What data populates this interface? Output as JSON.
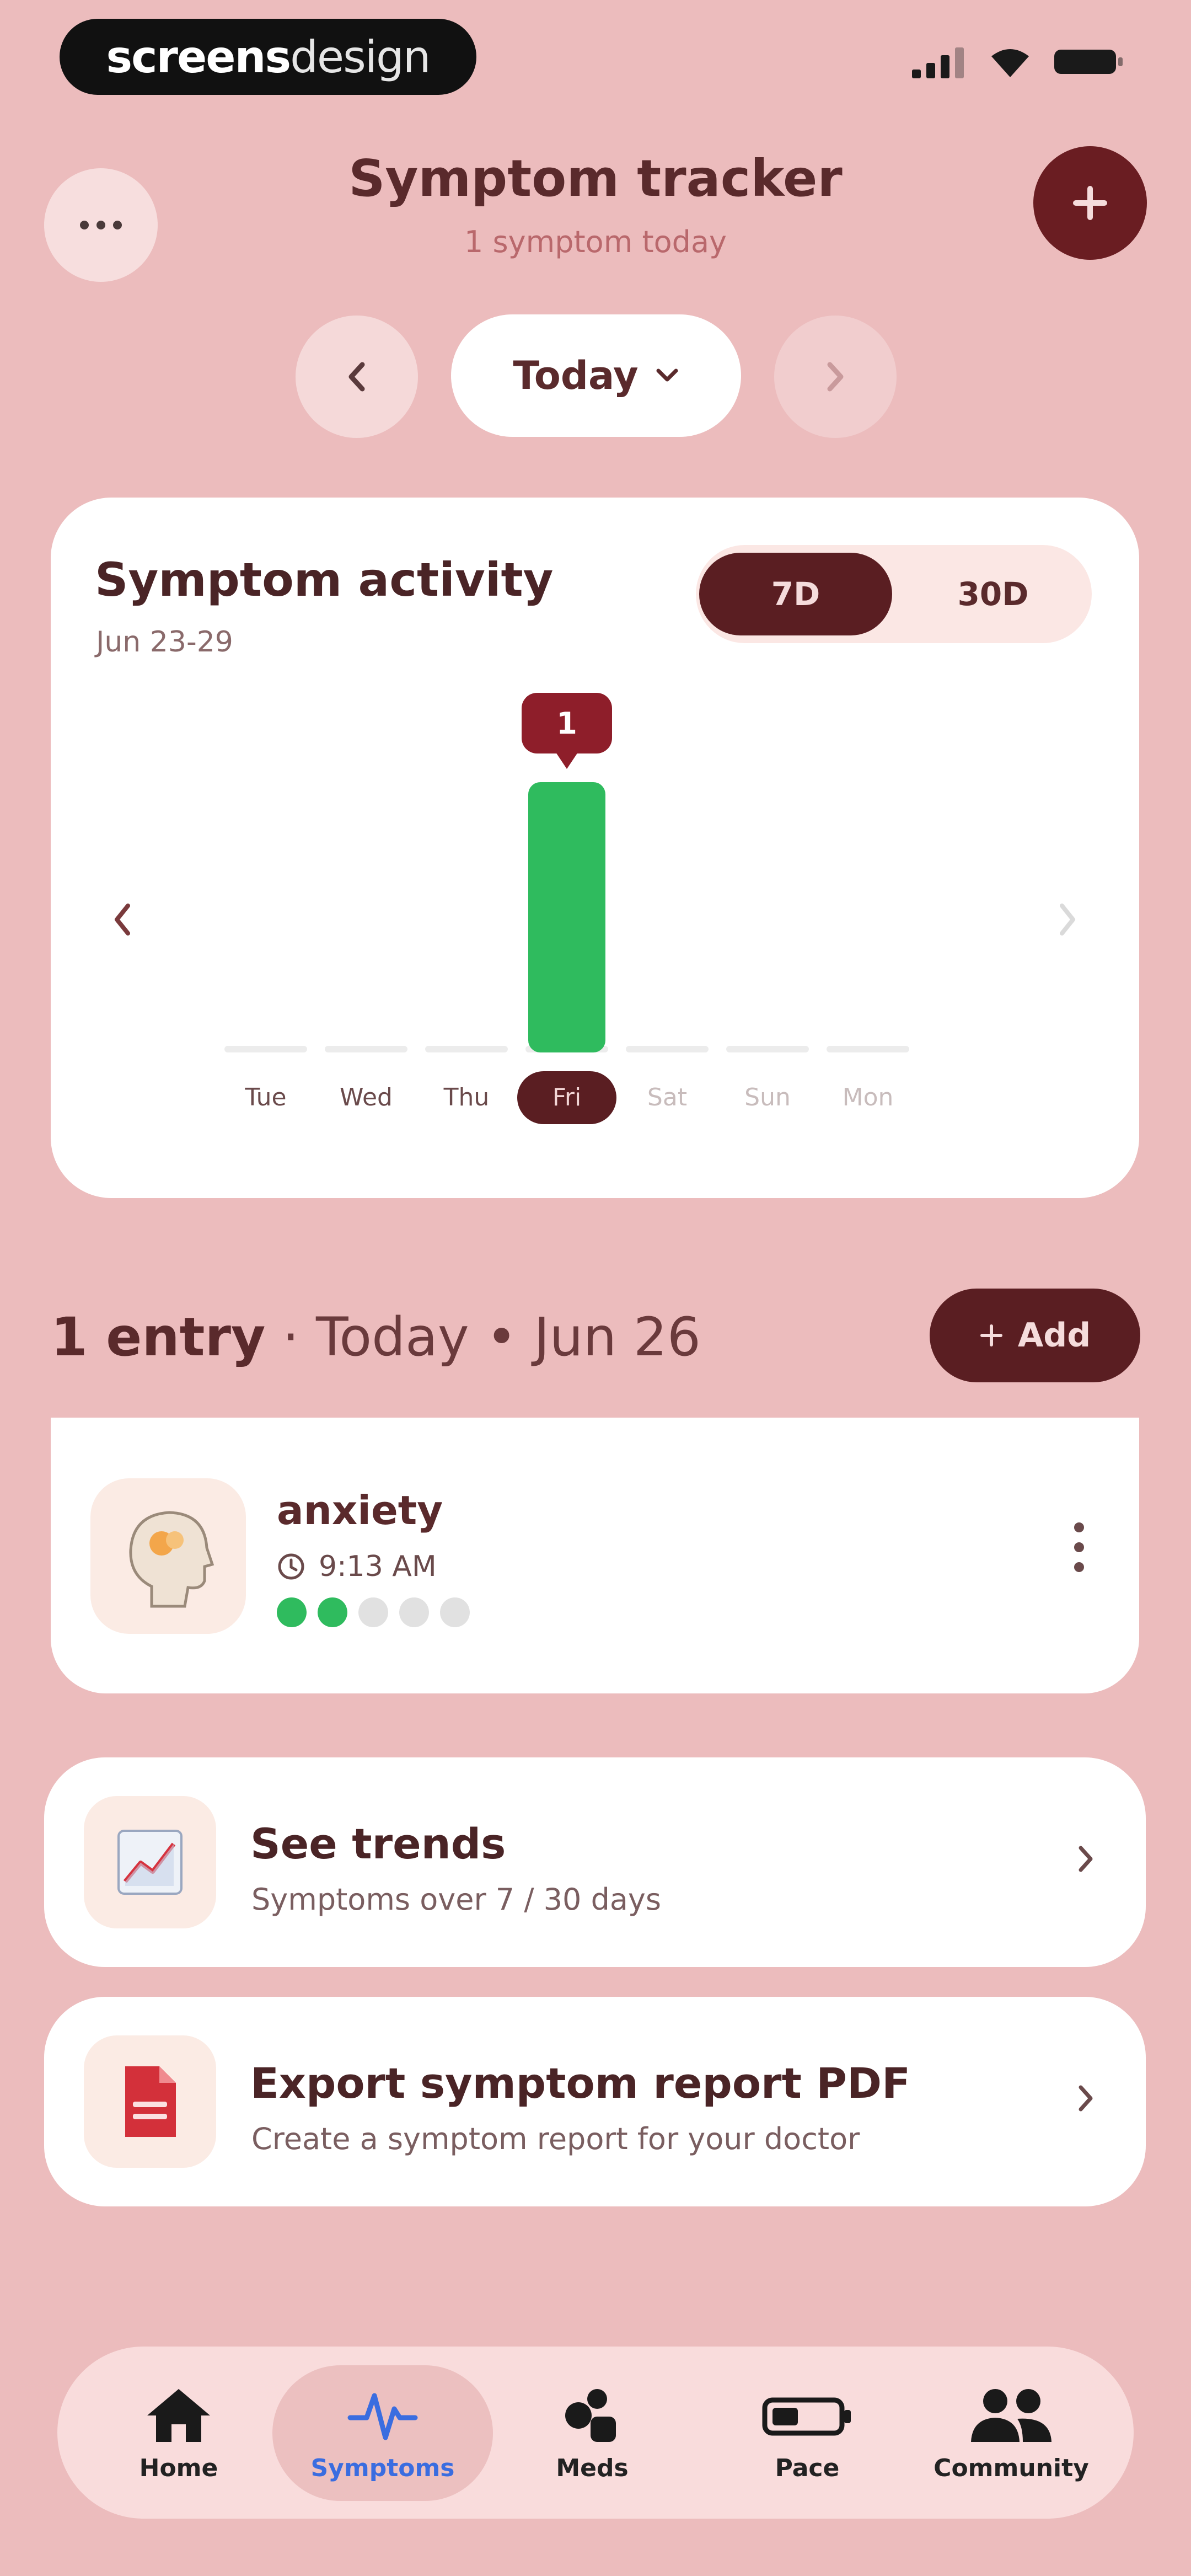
{
  "status_bar": {
    "brand_bold": "screens",
    "brand_light": "design"
  },
  "header": {
    "title": "Symptom tracker",
    "subtitle": "1 symptom today"
  },
  "date_nav": {
    "label": "Today"
  },
  "activity": {
    "title": "Symptom activity",
    "range": "Jun 23-29",
    "toggle": {
      "option_7d": "7D",
      "option_30d": "30D",
      "selected": "7D"
    }
  },
  "chart_data": {
    "type": "bar",
    "categories": [
      "Tue",
      "Wed",
      "Thu",
      "Fri",
      "Sat",
      "Sun",
      "Mon"
    ],
    "values": [
      0,
      0,
      0,
      1,
      0,
      0,
      0
    ],
    "active_index": 3,
    "tooltip": "1",
    "ylim": [
      0,
      1
    ],
    "bar_color": "#2fbb5e"
  },
  "entries": {
    "count_label": "1 entry",
    "date_label": " · Today • Jun 26",
    "add_label": "Add",
    "items": [
      {
        "name": "anxiety",
        "time": "9:13 AM",
        "severity": 2,
        "severity_max": 5
      }
    ]
  },
  "actions": {
    "trends": {
      "title": "See trends",
      "subtitle": "Symptoms over 7 / 30 days"
    },
    "export": {
      "title": "Export symptom report PDF",
      "subtitle": "Create a symptom report for your doctor"
    }
  },
  "bottom_nav": {
    "items": [
      {
        "label": "Home",
        "icon": "home-icon"
      },
      {
        "label": "Symptoms",
        "icon": "pulse-icon"
      },
      {
        "label": "Meds",
        "icon": "pills-icon"
      },
      {
        "label": "Pace",
        "icon": "battery-icon"
      },
      {
        "label": "Community",
        "icon": "people-icon"
      }
    ],
    "active_index": 1
  },
  "colors": {
    "background": "#ecbcbd",
    "accent_dark": "#5a1e22",
    "success": "#2fbb5e",
    "active_nav": "#3a6de0"
  }
}
